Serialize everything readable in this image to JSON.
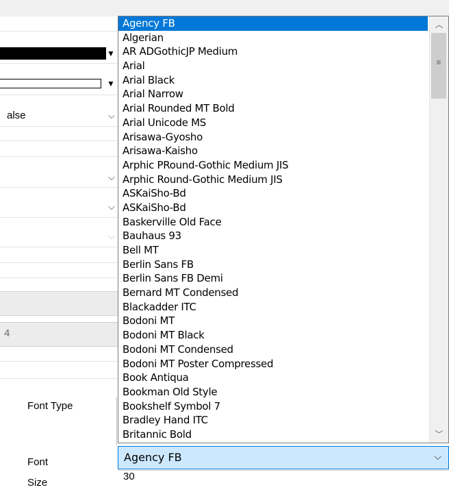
{
  "properties": {
    "bool_value": "alse",
    "number_value": "4"
  },
  "labels": {
    "font_type": "Font Type",
    "font": "Font",
    "size": "Size"
  },
  "font_dropdown": {
    "selected_index": 0,
    "items": [
      "Agency FB",
      "Algerian",
      "AR ADGothicJP Medium",
      "Arial",
      "Arial Black",
      "Arial Narrow",
      "Arial Rounded MT Bold",
      "Arial Unicode MS",
      "Arisawa-Gyosho",
      "Arisawa-Kaisho",
      "Arphic PRound-Gothic Medium JIS",
      "Arphic Round-Gothic Medium JIS",
      "ASKaiSho-Bd",
      "ASKaiSho-Bd",
      "Baskerville Old Face",
      "Bauhaus 93",
      "Bell MT",
      "Berlin Sans FB",
      "Berlin Sans FB Demi",
      "Bernard MT Condensed",
      "Blackadder ITC",
      "Bodoni MT",
      "Bodoni MT Black",
      "Bodoni MT Condensed",
      "Bodoni MT Poster Compressed",
      "Book Antiqua",
      "Bookman Old Style",
      "Bookshelf Symbol 7",
      "Bradley Hand ITC",
      "Britannic Bold"
    ]
  },
  "font_combo": {
    "value": "Agency FB"
  },
  "size_field": {
    "value": "30"
  },
  "colors": {
    "selection": "#0078d7",
    "combo_bg": "#cce8ff"
  }
}
